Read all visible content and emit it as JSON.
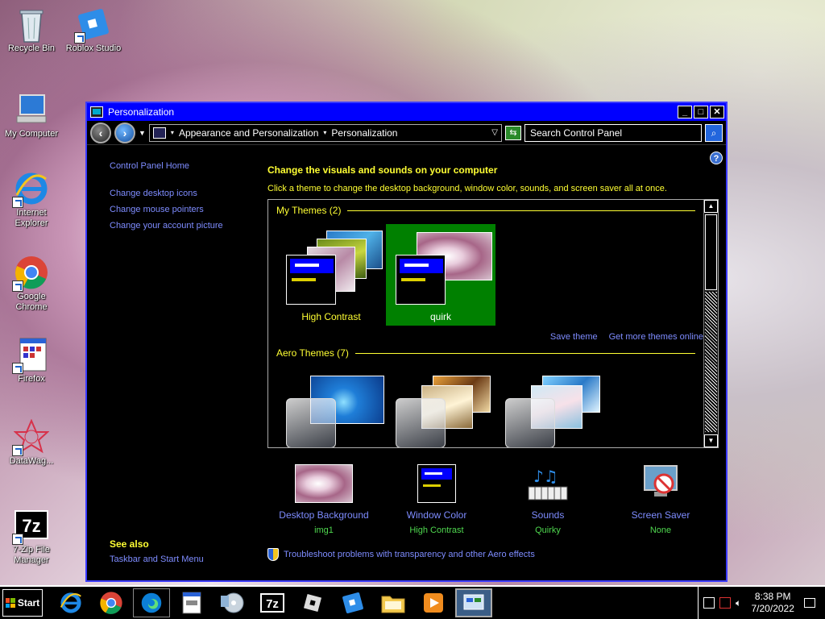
{
  "desktop": {
    "icons": [
      {
        "label": "Recycle Bin"
      },
      {
        "label": "Roblox Studio"
      },
      {
        "label": "My Computer"
      },
      {
        "label": "Internet Explorer"
      },
      {
        "label": "Google Chrome"
      },
      {
        "label": "Firefox"
      },
      {
        "label": "DataWag..."
      },
      {
        "label": "7-Zip File Manager"
      }
    ]
  },
  "window": {
    "title": "Personalization",
    "breadcrumb": [
      "Appearance and Personalization",
      "Personalization"
    ],
    "search_placeholder": "Search Control Panel",
    "left_nav": {
      "home": "Control Panel Home",
      "links": [
        "Change desktop icons",
        "Change mouse pointers",
        "Change your account picture"
      ]
    },
    "see_also": {
      "heading": "See also",
      "links": [
        "Taskbar and Start Menu"
      ]
    },
    "main_title": "Change the visuals and sounds on your computer",
    "main_subtitle": "Click a theme to change the desktop background, window color, sounds, and screen saver all at once.",
    "my_themes_heading": "My Themes (2)",
    "my_themes": [
      {
        "name": "High Contrast",
        "selected": false
      },
      {
        "name": "quirk",
        "selected": true
      }
    ],
    "save_theme": "Save theme",
    "get_more_themes": "Get more themes online",
    "aero_themes_heading": "Aero Themes (7)",
    "bottom": [
      {
        "label": "Desktop Background",
        "value": "img1"
      },
      {
        "label": "Window Color",
        "value": "High Contrast"
      },
      {
        "label": "Sounds",
        "value": "Quirky"
      },
      {
        "label": "Screen Saver",
        "value": "None"
      }
    ],
    "troubleshoot": "Troubleshoot problems with transparency and other Aero effects"
  },
  "taskbar": {
    "start_label": "Start",
    "time": "8:38 PM",
    "date": "7/20/2022"
  },
  "colors": {
    "accent_blue": "#0000ff",
    "hc_yellow": "#ffff33",
    "link": "#7e8cff",
    "value_green": "#4fd84f",
    "selected_green": "#008000"
  }
}
